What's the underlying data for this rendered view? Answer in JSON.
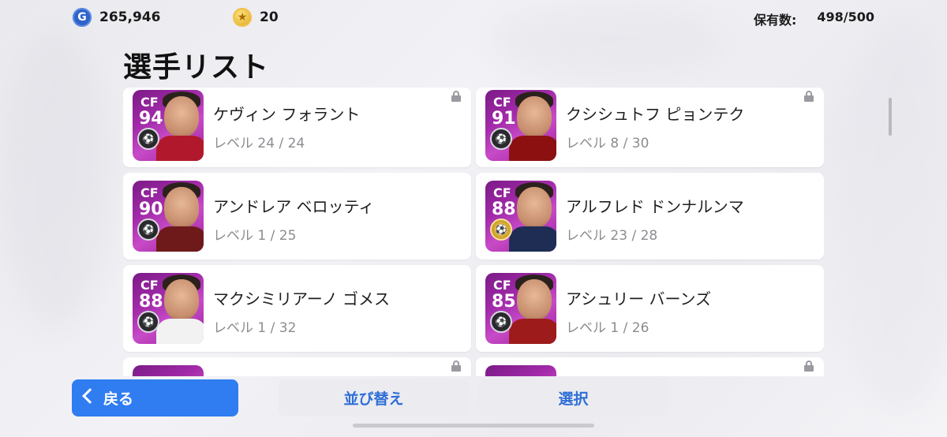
{
  "topbar": {
    "gp_value": "265,946",
    "coin_value": "20",
    "holding_label": "保有数:",
    "holding_value": "498/500"
  },
  "page": {
    "title": "選手リスト"
  },
  "players": [
    {
      "position": "CF",
      "rating": "94",
      "name": "ケヴィン フォラント",
      "level": "レベル 24 / 24",
      "locked": true,
      "badge": "silver",
      "shirt_color": "#b2182b"
    },
    {
      "position": "CF",
      "rating": "91",
      "name": "クシシュトフ ピョンテク",
      "level": "レベル 8 / 30",
      "locked": true,
      "badge": "silver",
      "shirt_color": "#8c1010"
    },
    {
      "position": "CF",
      "rating": "90",
      "name": "アンドレア ベロッティ",
      "level": "レベル 1 / 25",
      "locked": false,
      "badge": "silver",
      "shirt_color": "#6e1a1a"
    },
    {
      "position": "CF",
      "rating": "88",
      "name": "アルフレド ドンナルンマ",
      "level": "レベル 23 / 28",
      "locked": false,
      "badge": "gold",
      "shirt_color": "#1f2d55"
    },
    {
      "position": "CF",
      "rating": "88",
      "name": "マクシミリアーノ ゴメス",
      "level": "レベル 1 / 32",
      "locked": false,
      "badge": "silver",
      "shirt_color": "#f2f2f2"
    },
    {
      "position": "CF",
      "rating": "85",
      "name": "アシュリー バーンズ",
      "level": "レベル 1 / 26",
      "locked": false,
      "badge": "silver",
      "shirt_color": "#9e1b1b"
    }
  ],
  "buttons": {
    "back": "戻る",
    "sort": "並び替え",
    "select": "選択"
  }
}
